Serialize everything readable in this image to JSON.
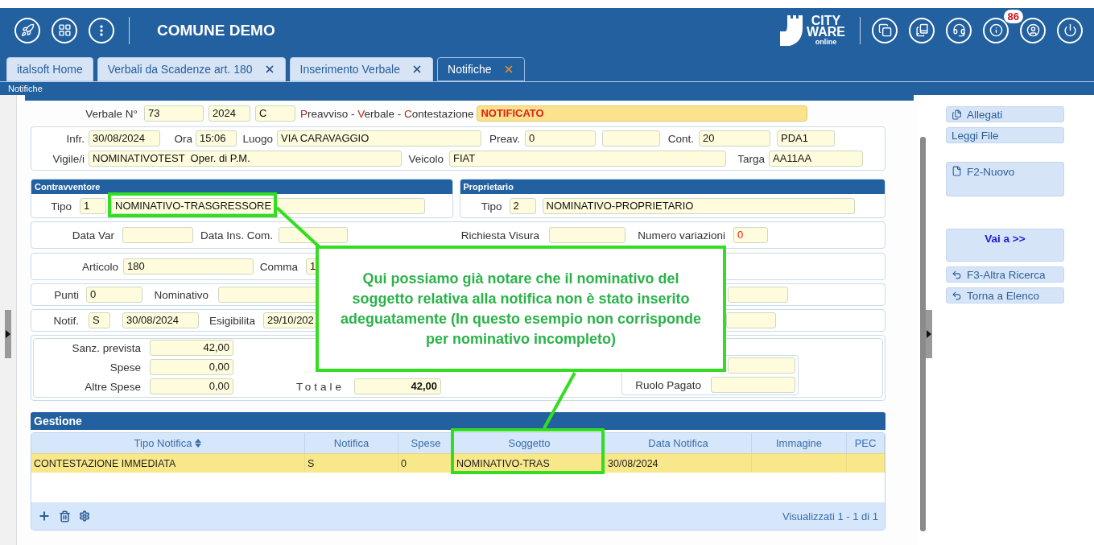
{
  "header": {
    "title": "COMUNE DEMO",
    "logo": [
      "CITY",
      "WARE",
      "online"
    ],
    "badge": "86"
  },
  "tabs": [
    {
      "label": "italsoft Home",
      "closable": false,
      "selected": false
    },
    {
      "label": "Verbali da Scadenze art. 180",
      "closable": true,
      "selected": false
    },
    {
      "label": "Inserimento Verbale",
      "closable": true,
      "selected": false
    },
    {
      "label": "Notifiche",
      "closable": true,
      "selected": true
    }
  ],
  "breadcrumb": "Notifiche",
  "verbale": [
    {
      "kind": "label",
      "text": "Verbale N°"
    },
    {
      "kind": "field",
      "value": "73"
    },
    {
      "kind": "field",
      "value": "2024"
    },
    {
      "kind": "field",
      "value": "C"
    },
    {
      "kind": "legend",
      "parts": [
        {
          "kind": "term",
          "text": "Preavviso"
        },
        {
          "kind": "sep",
          "text": " - "
        },
        {
          "kind": "term",
          "text": "Verbale"
        },
        {
          "kind": "sep",
          "text": " - "
        },
        {
          "kind": "term",
          "text": "Contestazione"
        }
      ]
    },
    {
      "kind": "status",
      "value": "NOTIFICATO"
    }
  ],
  "infrazione": [
    [
      {
        "kind": "label",
        "text": "Infr."
      },
      {
        "kind": "field",
        "value": "30/08/2024"
      },
      {
        "kind": "label",
        "text": "Ora"
      },
      {
        "kind": "field",
        "value": "15:06"
      },
      {
        "kind": "label",
        "text": "Luogo"
      },
      {
        "kind": "field",
        "value": "VIA CARAVAGGIO"
      },
      {
        "kind": "label",
        "text": "Preav."
      },
      {
        "kind": "field",
        "value": "0"
      },
      {
        "kind": "field"
      },
      {
        "kind": "label",
        "text": "Cont."
      },
      {
        "kind": "field",
        "value": "20"
      },
      {
        "kind": "field",
        "value": "PDA1"
      }
    ],
    [
      {
        "kind": "label",
        "text": "Vigile/i"
      },
      {
        "kind": "field",
        "value": "NOMINATIVOTEST  Oper. di P.M."
      },
      {
        "kind": "label",
        "text": "Veicolo"
      },
      {
        "kind": "field",
        "value": "FIAT"
      },
      {
        "kind": "label",
        "text": "Targa"
      },
      {
        "kind": "field",
        "value": "AA11AA"
      }
    ]
  ],
  "contravventore": {
    "title": "Contravventore",
    "items": [
      {
        "kind": "label",
        "text": "Tipo"
      },
      {
        "kind": "field",
        "value": "1"
      },
      {
        "kind": "field",
        "value": "NOMINATIVO-TRASGRESSORE"
      }
    ]
  },
  "proprietario": {
    "title": "Proprietario",
    "items": [
      {
        "kind": "label",
        "text": "Tipo"
      },
      {
        "kind": "field",
        "value": "2"
      },
      {
        "kind": "field",
        "value": "NOMINATIVO-PROPRIETARIO"
      }
    ]
  },
  "variazioni": [
    {
      "kind": "label",
      "text": "Data Var"
    },
    {
      "kind": "field"
    },
    {
      "kind": "label",
      "text": "Data Ins. Com."
    },
    {
      "kind": "field"
    },
    {
      "kind": "label",
      "text": "Richiesta Visura"
    },
    {
      "kind": "field"
    },
    {
      "kind": "label",
      "text": "Numero variazioni"
    },
    {
      "kind": "alert-field",
      "value": "0"
    }
  ],
  "articolo": [
    {
      "kind": "label",
      "text": "Articolo"
    },
    {
      "kind": "field",
      "value": "180"
    },
    {
      "kind": "label",
      "text": "Comma"
    },
    {
      "kind": "field",
      "value": "1"
    }
  ],
  "punti": [
    {
      "kind": "label",
      "text": "Punti"
    },
    {
      "kind": "field",
      "value": "0"
    },
    {
      "kind": "label",
      "text": "Nominativo"
    },
    {
      "kind": "field"
    },
    {
      "kind": "field"
    }
  ],
  "notifica": [
    {
      "kind": "label",
      "text": "Notif."
    },
    {
      "kind": "field",
      "value": "S"
    },
    {
      "kind": "field",
      "value": "30/08/2024"
    },
    {
      "kind": "label",
      "text": "Esigibilita"
    },
    {
      "kind": "field",
      "value": "29/10/202"
    },
    {
      "kind": "field"
    }
  ],
  "importi": {
    "rows": [
      {
        "label": "Sanz. prevista",
        "value": "42,00"
      },
      {
        "label": "Spese",
        "value": "0,00"
      },
      {
        "label": "Altre Spese",
        "value": "0,00"
      }
    ],
    "totale": {
      "label": "Totale",
      "value": "42,00"
    },
    "ruolo_pagato": "Ruolo Pagato"
  },
  "gestione": {
    "title": "Gestione",
    "columns": [
      {
        "label": "Tipo Notifica",
        "sorted": true
      },
      {
        "label": "Notifica",
        "sorted": false
      },
      {
        "label": "Spese",
        "sorted": false
      },
      {
        "label": "Soggetto",
        "sorted": false
      },
      {
        "label": "Data Notifica",
        "sorted": false
      },
      {
        "label": "Immagine",
        "sorted": false
      },
      {
        "label": "PEC",
        "sorted": false
      }
    ],
    "rows": [
      {
        "selected": true,
        "cells": [
          "CONTESTAZIONE IMMEDIATA",
          "S",
          "0",
          "NOMINATIVO-TRAS",
          "30/08/2024",
          null,
          null
        ]
      }
    ],
    "footer": "Visualizzati 1 - 1 di 1"
  },
  "side_buttons": [
    {
      "label": "Allegati",
      "kind": "attach"
    },
    {
      "label": "Leggi File",
      "kind": "plain"
    },
    {
      "label": "F2-Nuovo",
      "kind": "new"
    },
    {
      "label": "Vai a >>",
      "kind": "menu"
    },
    {
      "label": "F3-Altra Ricerca",
      "kind": "back"
    },
    {
      "label": "Torna a Elenco",
      "kind": "back"
    }
  ],
  "annotation": {
    "text": "Qui possiamo già notare che il nominativo del soggetto relativa alla notifica non è stato inserito adeguatamente (In questo esempio non corrisponde per nominativo incompleto)"
  }
}
